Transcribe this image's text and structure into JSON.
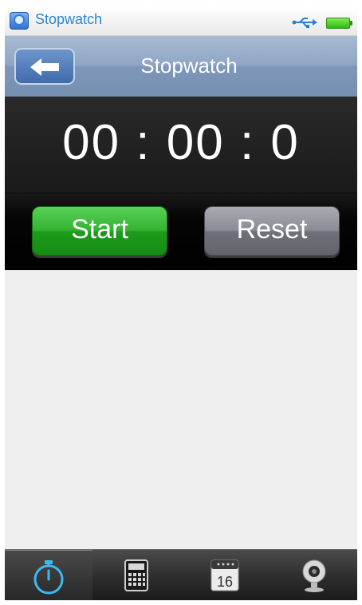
{
  "status_bar": {
    "app_title": "Stopwatch",
    "icons": [
      "stopwatch-app-icon",
      "usb-icon",
      "battery-icon"
    ]
  },
  "title_bar": {
    "title": "Stopwatch",
    "back_icon": "arrow-left-icon"
  },
  "timer": {
    "display": "00 : 00 : 0"
  },
  "controls": {
    "start_label": "Start",
    "reset_label": "Reset"
  },
  "tabs": [
    {
      "icon": "stopwatch-icon",
      "active": true
    },
    {
      "icon": "calculator-icon",
      "active": false
    },
    {
      "icon": "calendar-icon",
      "date": "16",
      "active": false
    },
    {
      "icon": "webcam-icon",
      "active": false
    }
  ],
  "colors": {
    "start": "#34b432",
    "reset": "#8b8c95",
    "accent": "#2a86d6",
    "title_bar": "#8fa6c4"
  }
}
